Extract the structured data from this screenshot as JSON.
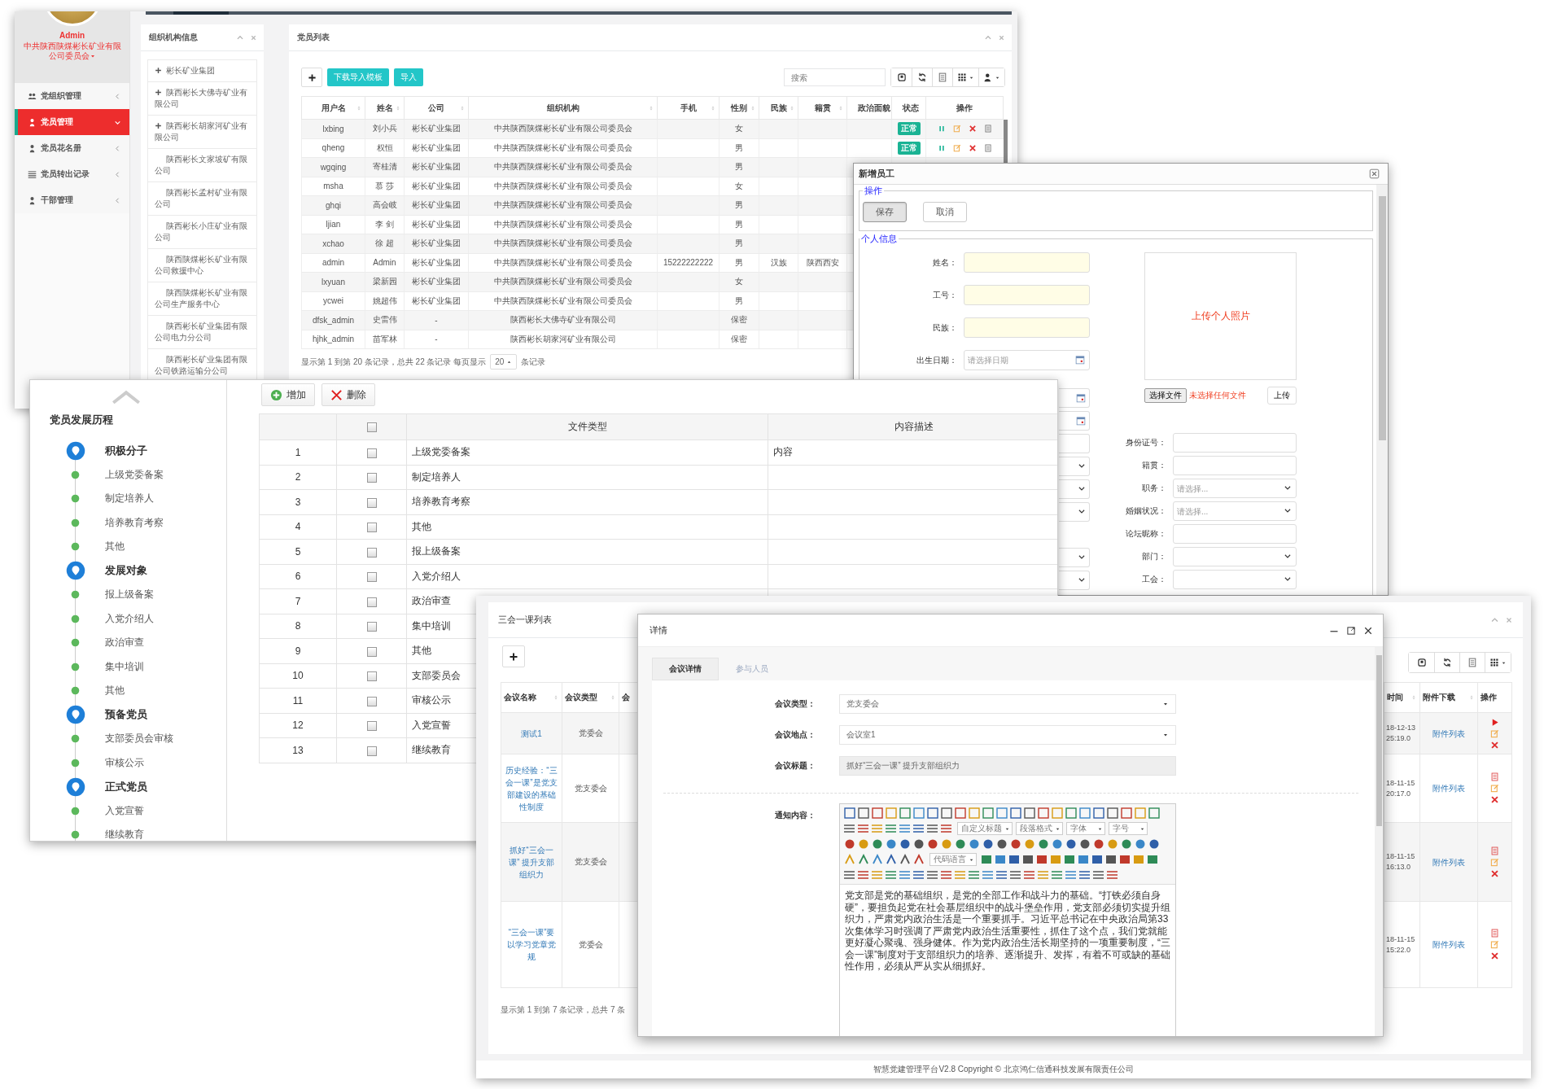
{
  "member_window": {
    "sidebar": {
      "user_name": "Admin",
      "organization": "中共陕西陕煤彬长矿业有限公司委员会",
      "menu": [
        {
          "label": "党组织管理",
          "selected": false
        },
        {
          "label": "党员管理",
          "selected": true
        },
        {
          "label": "党员花名册",
          "selected": false
        },
        {
          "label": "党员转出记录",
          "selected": false
        },
        {
          "label": "干部管理",
          "selected": false
        }
      ]
    },
    "org_panel": {
      "title": "组织机构信息",
      "items": [
        {
          "label": "彬长矿业集团",
          "expandable": true
        },
        {
          "label": "陕西彬长大佛寺矿业有限公司",
          "expandable": true
        },
        {
          "label": "陕西彬长胡家河矿业有限公司",
          "expandable": true
        },
        {
          "label": "陕西彬长文家坡矿有限公司",
          "expandable": false
        },
        {
          "label": "陕西彬长孟村矿业有限公司",
          "expandable": false
        },
        {
          "label": "陕西彬长小庄矿业有限公司",
          "expandable": false
        },
        {
          "label": "陕西陕煤彬长矿业有限公司救援中心",
          "expandable": false
        },
        {
          "label": "陕西陕煤彬长矿业有限公司生产服务中心",
          "expandable": false
        },
        {
          "label": "陕西彬长矿业集团有限公司电力分公司",
          "expandable": false
        },
        {
          "label": "陕西彬长矿业集团有限公司铁路运输分公司",
          "expandable": false
        }
      ]
    },
    "member_panel": {
      "title": "党员列表",
      "buttons": [
        "下载导入模板",
        "导入"
      ],
      "search": {
        "placeholder": "搜索"
      },
      "table": {
        "columns": [
          {
            "label": "用户名",
            "sortable": true
          },
          {
            "label": "姓名",
            "sortable": true
          },
          {
            "label": "公司",
            "sortable": true
          },
          {
            "label": "组织机构",
            "sortable": true
          },
          {
            "label": "手机",
            "sortable": true
          },
          {
            "label": "性别",
            "sortable": true
          },
          {
            "label": "民族",
            "sortable": true
          },
          {
            "label": "籍贯",
            "sortable": true
          },
          {
            "label": "政治面貌"
          },
          {
            "label": "状态",
            "sortable": false
          },
          {
            "label": "操作",
            "sortable": false
          }
        ],
        "rows": [
          {
            "username": "lxbing",
            "name": "刘小兵",
            "company": "彬长矿业集团",
            "organization": "中共陕西陕煤彬长矿业有限公司委员会",
            "gender": "女",
            "status": "正常"
          },
          {
            "username": "qheng",
            "name": "权恒",
            "company": "彬长矿业集团",
            "organization": "中共陕西陕煤彬长矿业有限公司委员会",
            "gender": "男",
            "status": "正常"
          },
          {
            "username": "wgqing",
            "name": "寄桂清",
            "company": "彬长矿业集团",
            "organization": "中共陕西陕煤彬长矿业有限公司委员会",
            "gender": "男"
          },
          {
            "username": "msha",
            "name": "慕 莎",
            "company": "彬长矿业集团",
            "organization": "中共陕西陕煤彬长矿业有限公司委员会",
            "gender": "女"
          },
          {
            "username": "ghqi",
            "name": "高会岐",
            "company": "彬长矿业集团",
            "organization": "中共陕西陕煤彬长矿业有限公司委员会",
            "gender": "男"
          },
          {
            "username": "ljian",
            "name": "李 剑",
            "company": "彬长矿业集团",
            "organization": "中共陕西陕煤彬长矿业有限公司委员会",
            "gender": "男"
          },
          {
            "username": "xchao",
            "name": "徐 超",
            "company": "彬长矿业集团",
            "organization": "中共陕西陕煤彬长矿业有限公司委员会",
            "gender": "男"
          },
          {
            "username": "admin",
            "name": "Admin",
            "company": "彬长矿业集团",
            "organization": "中共陕西陕煤彬长矿业有限公司委员会",
            "mobile": "15222222222",
            "gender": "男",
            "ethnicity": "汉族",
            "native_place": "陕西西安"
          },
          {
            "username": "lxyuan",
            "name": "梁新园",
            "company": "彬长矿业集团",
            "organization": "中共陕西陕煤彬长矿业有限公司委员会",
            "gender": "女"
          },
          {
            "username": "ycwei",
            "name": "姚超伟",
            "company": "彬长矿业集团",
            "organization": "中共陕西陕煤彬长矿业有限公司委员会",
            "gender": "男"
          },
          {
            "username": "dfsk_admin",
            "name": "史雷伟",
            "company": "-",
            "organization": "陕西彬长大佛寺矿业有限公司",
            "gender": "保密"
          },
          {
            "username": "hjhk_admin",
            "name": "苗军林",
            "company": "-",
            "organization": "陕西彬长胡家河矿业有限公司",
            "gender": "保密"
          }
        ]
      },
      "pagination": {
        "summary": "显示第 1 到第 20 条记录，总共 22 条记录 每页显示",
        "page_size": "20",
        "suffix": "条记录"
      }
    }
  },
  "new_employee_dialog": {
    "title": "新增员工",
    "actions": {
      "legend": "操作",
      "buttons": [
        {
          "label": "保存",
          "pressed": true
        },
        {
          "label": "取消",
          "pressed": false
        }
      ]
    },
    "personal_info": {
      "legend": "个人信息",
      "left_fields": [
        {
          "label": "姓名：",
          "kind": "required"
        },
        {
          "label": "工号：",
          "kind": "required"
        },
        {
          "label": "民族：",
          "kind": "required"
        },
        {
          "label": "出生日期：",
          "kind": "date",
          "placeholder": "请选择日期"
        },
        {
          "kind": "date"
        },
        {
          "kind": "date"
        },
        {
          "kind": "text"
        },
        {
          "kind": "select"
        },
        {
          "kind": "select"
        },
        {
          "kind": "select"
        },
        {
          "kind": "none"
        },
        {
          "kind": "select"
        },
        {
          "kind": "select"
        }
      ],
      "photo": {
        "prompt": "上传个人照片",
        "choose_button": "选择文件",
        "file_status": "未选择任何文件",
        "upload_button": "上传"
      },
      "right_fields": [
        {
          "label": "身份证号：",
          "kind": "text"
        },
        {
          "label": "籍贯：",
          "kind": "text"
        },
        {
          "label": "职务：",
          "kind": "select",
          "placeholder": "请选择..."
        },
        {
          "label": "婚姻状况：",
          "kind": "select",
          "placeholder": "请选择..."
        },
        {
          "label": "论坛昵称：",
          "kind": "text"
        },
        {
          "label": "部门：",
          "kind": "select"
        },
        {
          "label": "工会：",
          "kind": "select"
        }
      ]
    }
  },
  "development_window": {
    "timeline": {
      "title": "党员发展历程",
      "stages": [
        {
          "label": "积极分子",
          "children": [
            {
              "label": "上级党委备案"
            },
            {
              "label": "制定培养人"
            },
            {
              "label": "培养教育考察"
            },
            {
              "label": "其他"
            }
          ]
        },
        {
          "label": "发展对象",
          "children": [
            {
              "label": "报上级备案"
            },
            {
              "label": "入党介绍人"
            },
            {
              "label": "政治审查"
            },
            {
              "label": "集中培训"
            },
            {
              "label": "其他"
            }
          ]
        },
        {
          "label": "预备党员",
          "children": [
            {
              "label": "支部委员会审核"
            },
            {
              "label": "审核公示"
            }
          ]
        },
        {
          "label": "正式党员",
          "children": [
            {
              "label": "入党宣誓"
            },
            {
              "label": "继续教育"
            }
          ]
        }
      ]
    },
    "toolbar": [
      {
        "label": "增加",
        "kind": "add"
      },
      {
        "label": "删除",
        "kind": "delete"
      }
    ],
    "table": {
      "columns": [
        "文件类型",
        "内容描述"
      ],
      "all_checked": false,
      "rows": [
        {
          "number": "1",
          "type": "上级党委备案",
          "description": "内容",
          "checked": false
        },
        {
          "number": "2",
          "type": "制定培养人",
          "checked": false
        },
        {
          "number": "3",
          "type": "培养教育考察",
          "checked": false
        },
        {
          "number": "4",
          "type": "其他",
          "checked": false
        },
        {
          "number": "5",
          "type": "报上级备案",
          "checked": false
        },
        {
          "number": "6",
          "type": "入党介绍人",
          "checked": false
        },
        {
          "number": "7",
          "type": "政治审查",
          "checked": false
        },
        {
          "number": "8",
          "type": "集中培训",
          "checked": false
        },
        {
          "number": "9",
          "type": "其他",
          "checked": false
        },
        {
          "number": "10",
          "type": "支部委员会",
          "checked": false
        },
        {
          "number": "11",
          "type": "审核公示",
          "checked": false
        },
        {
          "number": "12",
          "type": "入党宣誓",
          "checked": false
        },
        {
          "number": "13",
          "type": "继续教育",
          "checked": false
        }
      ]
    }
  },
  "meeting_window": {
    "title": "三会一课列表",
    "table": {
      "columns": [
        {
          "label": "会议名称",
          "sortable": true
        },
        {
          "label": "会议类型",
          "sortable": true
        },
        {
          "label": "会"
        },
        {
          "label": "时间",
          "sortable": true
        },
        {
          "label": "附件下载",
          "sortable": true
        },
        {
          "label": "操作",
          "sortable": false
        }
      ],
      "rows": [
        {
          "name": "测试1",
          "type": "党委会",
          "time": [
            "18-12-13",
            "25:19.0"
          ],
          "attachment": "附件列表",
          "kind": "startable"
        },
        {
          "name": "历史经验：“三会一课”是党支部建设的基础性制度",
          "type": "党支委会",
          "time": [
            "18-11-15",
            "20:17.0"
          ],
          "attachment": "附件列表",
          "kind": "viewable"
        },
        {
          "name": "抓好“三会一课” 提升支部组织力",
          "type": "党支委会",
          "time": [
            "18-11-15",
            "16:13.0"
          ],
          "attachment": "附件列表",
          "kind": "viewable"
        },
        {
          "name": "“三会一课”要以学习党章党规",
          "type": "党委会",
          "time": [
            "18-11-15",
            "15:22.0"
          ],
          "attachment": "附件列表",
          "kind": "viewable"
        }
      ]
    },
    "summary": "显示第 1 到第 7 条记录，总共 7 条"
  },
  "footer": "智慧党建管理平台V2.8 Copyright © 北京鸿仁信通科技发展有限责任公司",
  "detail_dialog": {
    "title": "详情",
    "tabs": [
      {
        "label": "会议详情",
        "selected": true
      },
      {
        "label": "参与人员",
        "selected": false
      }
    ],
    "fields": [
      {
        "label": "会议类型：",
        "value": "党支委会",
        "kind": "select"
      },
      {
        "label": "会议地点：",
        "value": "会议室1",
        "kind": "select"
      },
      {
        "label": "会议标题：",
        "value": "抓好“三会一课” 提升支部组织力",
        "kind": "readonly"
      }
    ],
    "editor": {
      "label": "通知内容：",
      "toolbar_dropdowns": [
        "自定义标题",
        "段落格式",
        "字体",
        "字号"
      ],
      "code_language": "代码语言",
      "content": "党支部是党的基础组织，是党的全部工作和战斗力的基础。“打铁必须自身硬”，要担负起党在社会基层组织中的战斗堡垒作用，党支部必须切实提升组织力，严肃党内政治生活是一个重要抓手。习近平总书记在中央政治局第33次集体学习时强调了严肃党内政治生活重要性，抓住了这个点，我们党就能更好凝心聚魂、强身健体。作为党内政治生活长期坚持的一项重要制度，“三会一课”制度对于支部组织力的培养、逐渐提升、发挥，有着不可或缺的基础性作用，必须从严从实从细抓好。"
    }
  }
}
